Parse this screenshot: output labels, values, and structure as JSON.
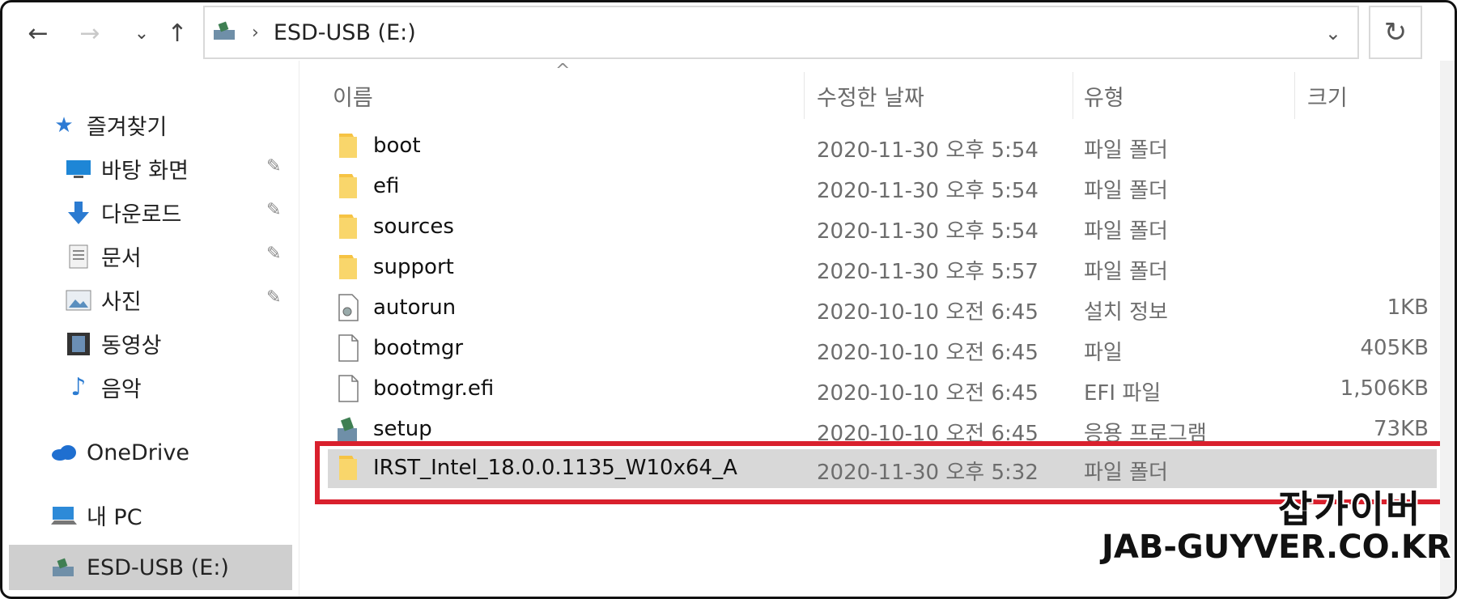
{
  "address": {
    "path": "ESD-USB (E:)"
  },
  "columns": {
    "name": "이름",
    "date": "수정한 날짜",
    "type": "유형",
    "size": "크기"
  },
  "sidebar": {
    "quick_access": "즐겨찾기",
    "desktop": "바탕 화면",
    "downloads": "다운로드",
    "documents": "문서",
    "pictures": "사진",
    "videos": "동영상",
    "music": "음악",
    "onedrive": "OneDrive",
    "this_pc": "내 PC",
    "usb": "ESD-USB (E:)"
  },
  "files": [
    {
      "name": "boot",
      "date": "2020-11-30 오후 5:54",
      "type": "파일 폴더",
      "size": "",
      "icon": "folder-icon"
    },
    {
      "name": "efi",
      "date": "2020-11-30 오후 5:54",
      "type": "파일 폴더",
      "size": "",
      "icon": "folder-icon"
    },
    {
      "name": "sources",
      "date": "2020-11-30 오후 5:54",
      "type": "파일 폴더",
      "size": "",
      "icon": "folder-icon"
    },
    {
      "name": "support",
      "date": "2020-11-30 오후 5:57",
      "type": "파일 폴더",
      "size": "",
      "icon": "folder-icon"
    },
    {
      "name": "autorun",
      "date": "2020-10-10 오전 6:45",
      "type": "설치 정보",
      "size": "1KB",
      "icon": "settings-file-icon"
    },
    {
      "name": "bootmgr",
      "date": "2020-10-10 오전 6:45",
      "type": "파일",
      "size": "405KB",
      "icon": "file-icon"
    },
    {
      "name": "bootmgr.efi",
      "date": "2020-10-10 오전 6:45",
      "type": "EFI 파일",
      "size": "1,506KB",
      "icon": "file-icon"
    },
    {
      "name": "setup",
      "date": "2020-10-10 오전 6:45",
      "type": "응용 프로그램",
      "size": "73KB",
      "icon": "setup-icon"
    },
    {
      "name": "IRST_Intel_18.0.0.1135_W10x64_A",
      "date": "2020-11-30 오후 5:32",
      "type": "파일 폴더",
      "size": "",
      "icon": "folder-icon"
    }
  ],
  "watermark": {
    "line1": "잡가이버",
    "line2": "JAB-GUYVER.CO.KR"
  },
  "colors": {
    "highlight_border": "#d9202d",
    "folder": "#f6c343",
    "selection": "#d8d8d8"
  }
}
